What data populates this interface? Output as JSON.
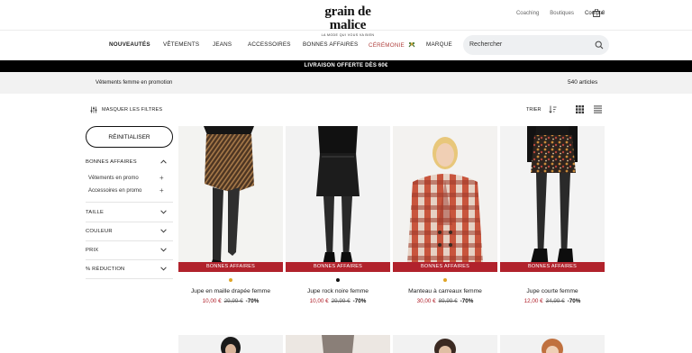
{
  "header": {
    "logo_text": "grain de malice",
    "tagline": "LA MODE QUI VOUS VA BIEN",
    "links": [
      "Coaching",
      "Boutiques",
      "Compte"
    ],
    "cart_count": "0"
  },
  "nav": {
    "items": [
      "NOUVEAUTÉS",
      "VÊTEMENTS",
      "JEANS",
      "ACCESSOIRES",
      "BONNES AFFAIRES",
      "CÉRÉMONIE",
      "MARQUE"
    ],
    "search_placeholder": "Rechercher"
  },
  "promo_text": "LIVRAISON OFFERTE DÈS 60€",
  "page": {
    "title": "Vêtements femme en promotion",
    "count": "540 articles"
  },
  "toolbar": {
    "filters_label": "MASQUER LES FILTRES",
    "sort_label": "TRIER"
  },
  "sidebar": {
    "reset_label": "RÉINITIALISER",
    "facets": [
      "BONNES AFFAIRES",
      "TAILLE",
      "COULEUR",
      "PRIX",
      "% RÉDUCTION"
    ],
    "sub_items": [
      "Vêtements en promo",
      "Accessoires en promo"
    ]
  },
  "products": [
    {
      "badge": "BONNES AFFAIRES",
      "name": "Jupe en maille drapée femme",
      "price": "10,00 €",
      "old_price": "29,99 €",
      "discount": "-70%",
      "swatch": "#e0a526"
    },
    {
      "badge": "BONNES AFFAIRES",
      "name": "Jupe rock noire femme",
      "price": "10,00 €",
      "old_price": "29,99 €",
      "discount": "-70%",
      "swatch": "#111111"
    },
    {
      "badge": "BONNES AFFAIRES",
      "name": "Manteau à carreaux femme",
      "price": "30,00 €",
      "old_price": "89,99 €",
      "discount": "-70%",
      "swatch": "#e0a526"
    },
    {
      "badge": "BONNES AFFAIRES",
      "name": "Jupe courte femme",
      "price": "12,00 €",
      "old_price": "34,99 €",
      "discount": "-70%",
      "swatch": ""
    }
  ],
  "colors": {
    "accent_red": "#b1222c",
    "promo_bar": "#000000",
    "ceremony_link": "#b0413e"
  }
}
